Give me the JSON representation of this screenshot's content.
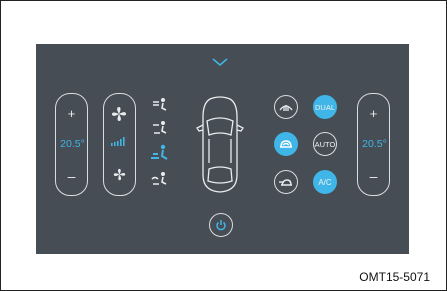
{
  "climate": {
    "left_temp": "20.5°",
    "right_temp": "20.5°",
    "plus": "+",
    "minus": "–",
    "dual_label": "DUAL",
    "auto_label": "AUTO",
    "ac_label": "A/C",
    "dual_on": true,
    "ac_on": true,
    "recirc_on": true,
    "accent_color": "#3fb6e7",
    "panel_color": "#474d54"
  },
  "caption": "OMT15-5071"
}
